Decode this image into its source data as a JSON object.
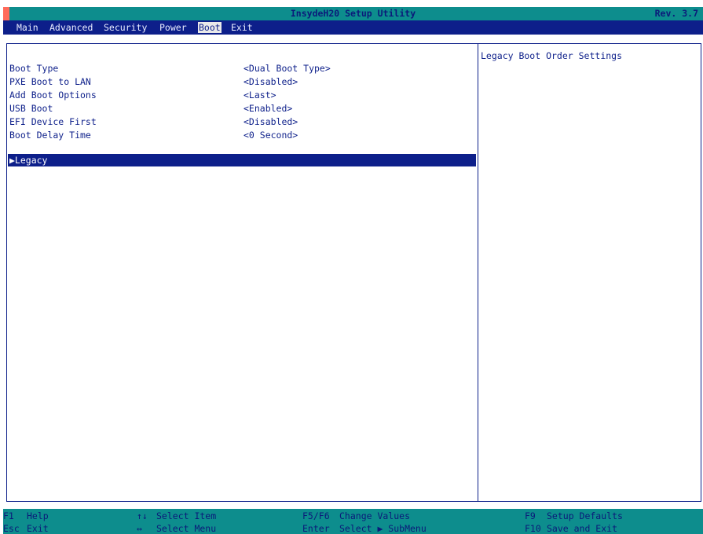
{
  "header": {
    "title": "InsydeH20 Setup Utility",
    "revision": "Rev. 3.7"
  },
  "tabs": [
    {
      "label": "Main"
    },
    {
      "label": "Advanced"
    },
    {
      "label": "Security"
    },
    {
      "label": "Power"
    },
    {
      "label": "Boot",
      "active": true
    },
    {
      "label": "Exit"
    }
  ],
  "settings": [
    {
      "label": "Boot Type",
      "value": "<Dual Boot Type>"
    },
    {
      "label": "PXE Boot to LAN",
      "value": "<Disabled>"
    },
    {
      "label": "Add Boot Options",
      "value": "<Last>"
    },
    {
      "label": "USB Boot",
      "value": "<Enabled>"
    },
    {
      "label": "EFI Device First",
      "value": "<Disabled>"
    },
    {
      "label": "Boot Delay Time",
      "value": "<0 Second>"
    }
  ],
  "submenu": {
    "label": "▶Legacy"
  },
  "help": {
    "text": "Legacy Boot Order Settings"
  },
  "footer": {
    "f1_key": "F1",
    "f1_desc": "Help",
    "esc_key": "Esc",
    "esc_desc": "Exit",
    "updown_key": "↑↓",
    "updown_desc": "Select Item",
    "leftright_key": "↔",
    "leftright_desc": "Select Menu",
    "f5f6_key": "F5/F6",
    "f5f6_desc": "Change Values",
    "enter_key": "Enter",
    "enter_desc": "Select ▶ SubMenu",
    "f9_key": "F9",
    "f9_desc": "Setup Defaults",
    "f10_key": "F10",
    "f10_desc": "Save and Exit"
  },
  "colors": {
    "teal_bar": "#0d8d8d",
    "navy": "#0d1f8a",
    "accent": "#ff6a5a"
  }
}
